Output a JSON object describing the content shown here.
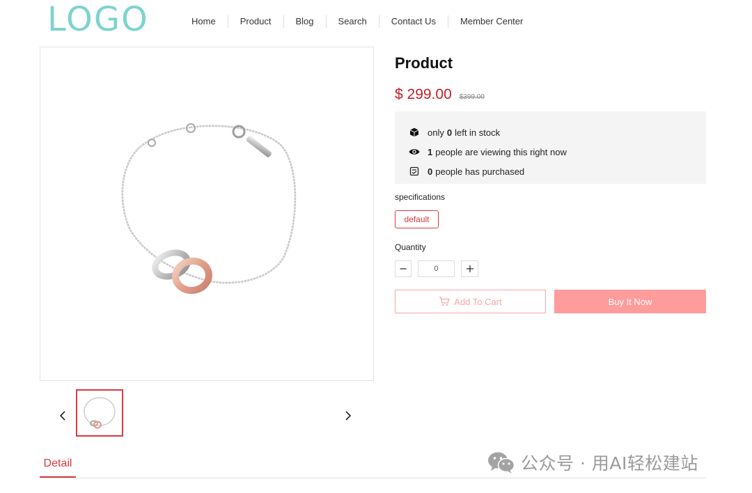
{
  "header": {
    "logo": "LOGO",
    "nav": [
      "Home",
      "Product",
      "Blog",
      "Search",
      "Contact Us",
      "Member Center"
    ]
  },
  "gallery": {
    "main_image": "bracelet-product-photo",
    "thumbnails": [
      "bracelet-thumbnail"
    ],
    "prev_icon": "chevron-left-icon",
    "next_icon": "chevron-right-icon"
  },
  "product": {
    "title": "Product",
    "price": "$ 299.00",
    "original_price": "$399.00",
    "stock": {
      "prefix": "only",
      "count": "0",
      "suffix": "left in stock",
      "icon": "box-icon"
    },
    "viewers": {
      "count": "1",
      "suffix": "people are viewing this right now",
      "icon": "eye-icon"
    },
    "purchases": {
      "count": "0",
      "suffix": "people has purchased",
      "icon": "receipt-icon"
    },
    "specifications_label": "specifications",
    "specification_options": [
      "default"
    ],
    "quantity_label": "Quantity",
    "quantity_value": "0",
    "add_to_cart_label": "Add To Cart",
    "buy_now_label": "Buy It Now"
  },
  "tabs": [
    "Detail"
  ],
  "watermark": "公众号 · 用AI轻松建站",
  "colors": {
    "logo": "#7dd3cf",
    "price": "#c32126",
    "accent": "#d9393f",
    "buy_button": "#fe9c9c",
    "cart_button_border": "#f4a6a6",
    "info_box_bg": "#f4f4f4"
  }
}
